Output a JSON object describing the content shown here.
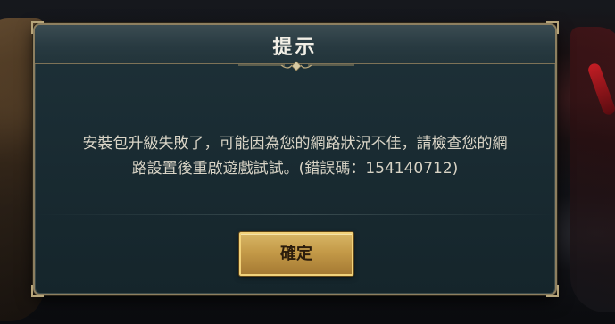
{
  "dialog": {
    "title": "提示",
    "message_line1": "安裝包升級失敗了，可能因為您的網路狀況不佳，請檢查您的網",
    "message_line2": "路設置後重啟遊戲試試。(錯誤碼：154140712)",
    "confirm_label": "確定"
  },
  "icons": {
    "header_ornament": "diamond-ornament-icon"
  },
  "colors": {
    "panel": "#1e3138",
    "border": "#8d7f60",
    "button_gold": "#c49a48",
    "title_text": "#f2efe6",
    "body_text": "#d9d4c6"
  }
}
